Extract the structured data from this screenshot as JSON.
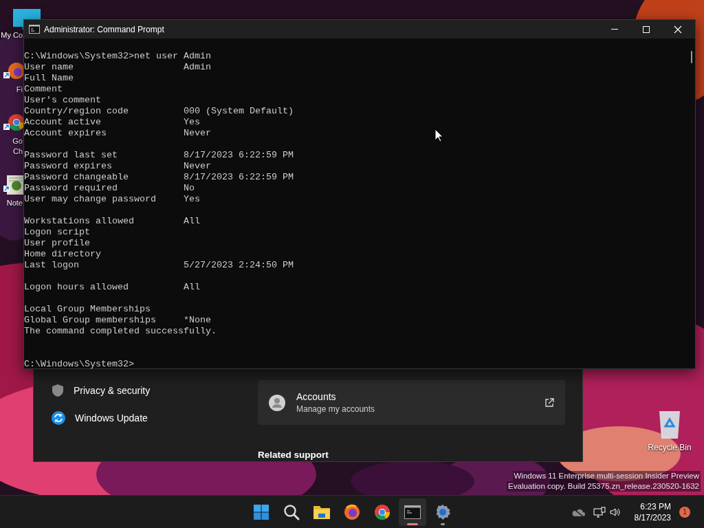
{
  "desktop": {
    "icons": [
      {
        "kind": "computer",
        "lines": [
          "My Co"
        ]
      },
      {
        "kind": "firefox",
        "lines": [
          "Fi"
        ]
      },
      {
        "kind": "chrome",
        "lines": [
          "Go",
          "Ch"
        ]
      },
      {
        "kind": "notepad",
        "lines": [
          "Note"
        ]
      }
    ],
    "recycle_bin": {
      "label": "Recycle Bin"
    },
    "watermark": [
      "Windows 11 Enterprise multi-session Insider Preview",
      "Evaluation copy. Build 25375.zn_release.230520-1632"
    ]
  },
  "settings_window": {
    "nav_items": [
      {
        "kind": "shield",
        "label": "Privacy & security"
      },
      {
        "kind": "update",
        "label": "Windows Update"
      }
    ],
    "card": {
      "title": "Accounts",
      "subtitle": "Manage my accounts"
    },
    "section_heading": "Related support"
  },
  "cmd_window": {
    "title": "Administrator: Command Prompt",
    "blocks": [
      [
        {
          "kind": "command",
          "text": "C:\\Windows\\System32>net user Admin"
        },
        {
          "kind": "field",
          "label": "User name",
          "value": "Admin"
        },
        {
          "kind": "field",
          "label": "Full Name"
        },
        {
          "kind": "field",
          "label": "Comment"
        },
        {
          "kind": "field",
          "label": "User's comment"
        },
        {
          "kind": "field",
          "label": "Country/region code",
          "value": "000 (System Default)"
        },
        {
          "kind": "field",
          "label": "Account active",
          "value": "Yes"
        },
        {
          "kind": "field",
          "label": "Account expires",
          "value": "Never"
        }
      ],
      [
        {
          "kind": "field",
          "label": "Password last set",
          "value": "8/17/2023 6:22:59 PM"
        },
        {
          "kind": "field",
          "label": "Password expires",
          "value": "Never"
        },
        {
          "kind": "field",
          "label": "Password changeable",
          "value": "8/17/2023 6:22:59 PM"
        },
        {
          "kind": "field",
          "label": "Password required",
          "value": "No"
        },
        {
          "kind": "field",
          "label": "User may change password",
          "value": "Yes"
        }
      ],
      [
        {
          "kind": "field",
          "label": "Workstations allowed",
          "value": "All"
        },
        {
          "kind": "field",
          "label": "Logon script"
        },
        {
          "kind": "field",
          "label": "User profile"
        },
        {
          "kind": "field",
          "label": "Home directory"
        },
        {
          "kind": "field",
          "label": "Last logon",
          "value": "5/27/2023 2:24:50 PM"
        }
      ],
      [
        {
          "kind": "field",
          "label": "Logon hours allowed",
          "value": "All"
        }
      ],
      [
        {
          "kind": "field",
          "label": "Local Group Memberships"
        },
        {
          "kind": "field",
          "label": "Global Group memberships",
          "value": "*None"
        },
        {
          "kind": "text",
          "text": "The command completed successfully."
        }
      ]
    ],
    "prompt": "C:\\Windows\\System32>"
  },
  "taskbar": {
    "apps": [
      {
        "kind": "start",
        "active": false,
        "running": false
      },
      {
        "kind": "search",
        "active": false,
        "running": false
      },
      {
        "kind": "folder",
        "active": false,
        "running": false
      },
      {
        "kind": "firefox",
        "active": false,
        "running": false
      },
      {
        "kind": "chrome",
        "active": false,
        "running": false
      },
      {
        "kind": "terminal",
        "active": true,
        "running": true
      },
      {
        "kind": "settings",
        "active": false,
        "running": true
      }
    ],
    "tray": {
      "time": "6:23 PM",
      "date": "8/17/2023",
      "notifications": "1"
    }
  }
}
